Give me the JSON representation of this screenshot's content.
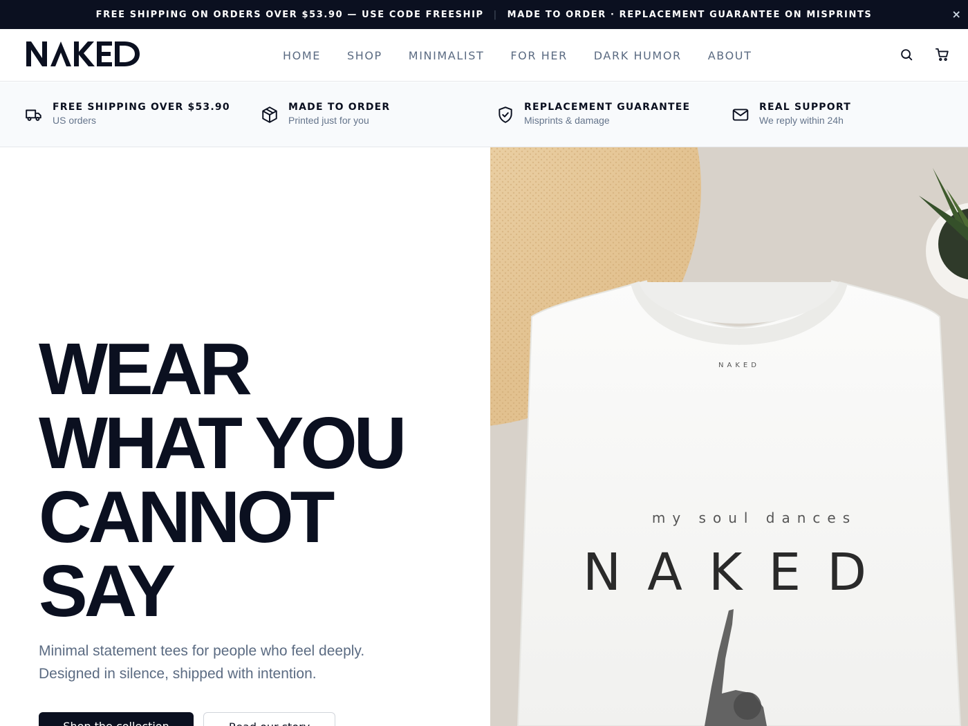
{
  "announcement": {
    "left": "FREE SHIPPING ON ORDERS OVER $53.90 — USE CODE FREESHIP",
    "separator": "|",
    "right": "MADE TO ORDER · REPLACEMENT GUARANTEE ON MISPRINTS",
    "close": "×"
  },
  "brand": {
    "logo": "NAKED"
  },
  "nav": {
    "items": [
      "HOME",
      "SHOP",
      "MINIMALIST",
      "FOR HER",
      "DARK HUMOR",
      "ABOUT"
    ]
  },
  "header_icons": [
    "search-icon",
    "cart-icon"
  ],
  "features": [
    {
      "icon": "truck-icon",
      "title": "FREE SHIPPING OVER $53.90",
      "subtitle": "US orders"
    },
    {
      "icon": "box-icon",
      "title": "MADE TO ORDER",
      "subtitle": "Printed just for you"
    },
    {
      "icon": "shield-check-icon",
      "title": "REPLACEMENT GUARANTEE",
      "subtitle": "Misprints & damage"
    },
    {
      "icon": "mail-icon",
      "title": "REAL SUPPORT",
      "subtitle": "We reply within 24h"
    }
  ],
  "hero": {
    "title_lines": [
      "WEAR",
      "WHAT YOU",
      "CANNOT",
      "SAY"
    ],
    "subtitle_lines": [
      "Minimal statement tees for people who feel deeply.",
      "Designed in silence, shipped with intention."
    ],
    "primary_button": "Shop the collection",
    "secondary_button": "Read our story",
    "image": {
      "shirt_tag": "NAKED",
      "shirt_line": "my soul dances",
      "shirt_brand": "NAKED"
    }
  },
  "colors": {
    "ink": "#0b1020",
    "muted": "#5b6b82",
    "strip_bg": "#f8fafc",
    "photo_bg": "#d8d2ca"
  }
}
